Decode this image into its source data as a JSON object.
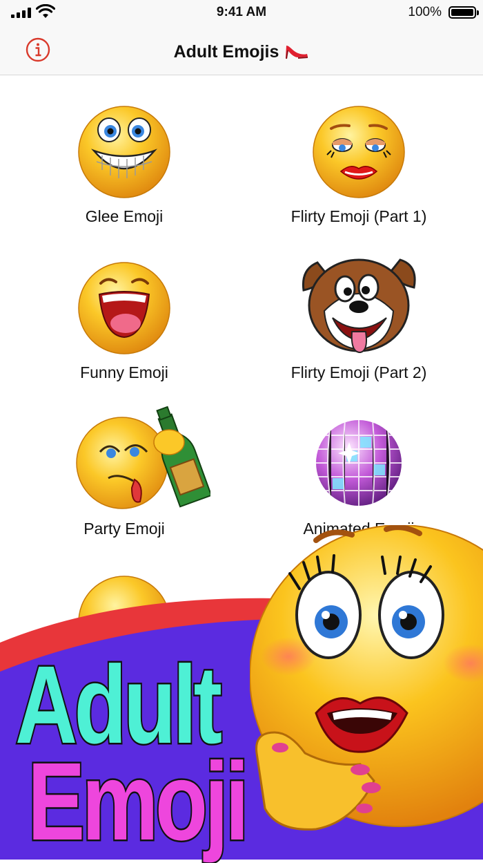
{
  "status_bar": {
    "time": "9:41 AM",
    "battery": "100%"
  },
  "nav": {
    "title": "Adult Emojis"
  },
  "items": [
    {
      "label": "Glee Emoji"
    },
    {
      "label": "Flirty Emoji (Part 1)"
    },
    {
      "label": "Funny Emoji"
    },
    {
      "label": "Flirty Emoji (Part 2)"
    },
    {
      "label": "Party Emoji"
    },
    {
      "label": "Animated Emoji"
    }
  ],
  "promo": {
    "line1": "Adult",
    "line2": "Emoji"
  },
  "colors": {
    "accent": "#d9392b",
    "promo_purple": "#5b2be0",
    "promo_red": "#e8363a",
    "cyan": "#4ef0d5",
    "magenta": "#ee46dd",
    "emoji_yellow": "#f5b81e"
  }
}
